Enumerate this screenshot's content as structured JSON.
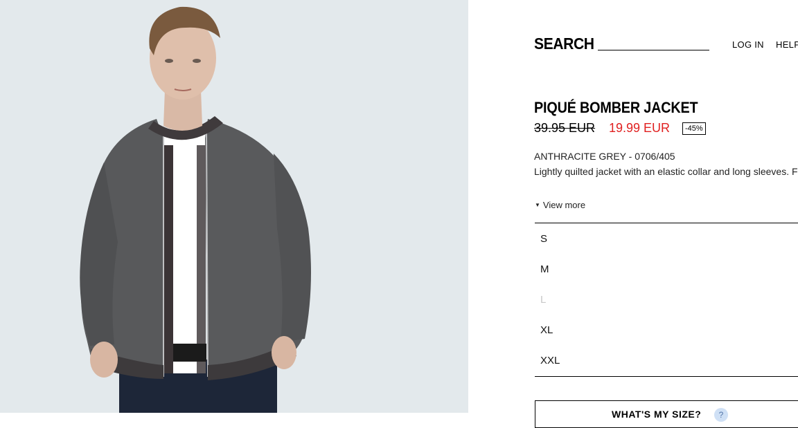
{
  "header": {
    "search_label": "SEARCH",
    "search_placeholder": "",
    "login_label": "LOG IN",
    "help_label": "HELP"
  },
  "product": {
    "title": "PIQUÉ BOMBER JACKET",
    "old_price": "39.95 EUR",
    "new_price": "19.99 EUR",
    "discount": "-45%",
    "color_ref": "ANTHRACITE GREY - 0706/405",
    "description": "Lightly quilted jacket with an elastic collar and long sleeves. Featuring front welt pockets, contrast ribbed",
    "view_more": "View more",
    "image_icon": "product-photo"
  },
  "sizes": [
    {
      "label": "S",
      "available": true
    },
    {
      "label": "M",
      "available": true
    },
    {
      "label": "L",
      "available": false
    },
    {
      "label": "XL",
      "available": true
    },
    {
      "label": "XXL",
      "available": true
    }
  ],
  "size_guide": {
    "label": "WHAT'S MY SIZE?",
    "help_icon": "?"
  },
  "colors": {
    "price_sale": "#e02020",
    "photo_bg": "#e3e9ec",
    "unavailable": "#c8c8c8"
  }
}
